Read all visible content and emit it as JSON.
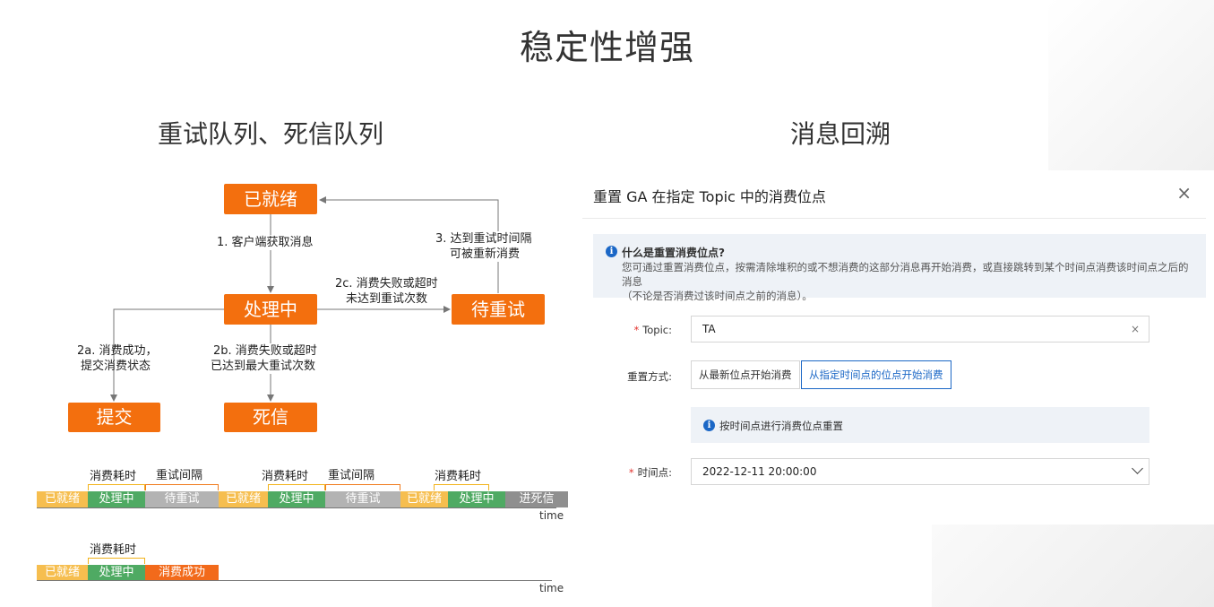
{
  "title": "稳定性增强",
  "left": {
    "subtitle": "重试队列、死信队列",
    "nodes": {
      "ready": "已就绪",
      "processing": "处理中",
      "waiting_retry": "待重试",
      "commit": "提交",
      "dead_letter": "死信"
    },
    "edges": {
      "e1": "1. 客户端获取消息",
      "e2a_1": "2a. 消费成功，",
      "e2a_2": "提交消费状态",
      "e2b_1": "2b. 消费失败或超时",
      "e2b_2": "已达到最大重试次数",
      "e2c_1": "2c. 消费失败或超时",
      "e2c_2": "未达到重试次数",
      "e3_1": "3. 达到重试时间隔",
      "e3_2": "可被重新消费"
    },
    "timeline1": {
      "segments": [
        "已就绪",
        "处理中",
        "待重试",
        "已就绪",
        "处理中",
        "待重试",
        "已就绪",
        "处理中",
        "进死信"
      ],
      "brackets": [
        "消费耗时",
        "重试间隔",
        "消费耗时",
        "重试间隔",
        "消费耗时"
      ],
      "axis_label": "time"
    },
    "timeline2": {
      "segments": [
        "已就绪",
        "处理中",
        "消费成功"
      ],
      "brackets": [
        "消费耗时"
      ],
      "axis_label": "time"
    }
  },
  "right": {
    "subtitle": "消息回溯",
    "dialog": {
      "title": "重置 GA 在指定 Topic 中的消费位点",
      "close_icon": "×",
      "info_title": "什么是重置消费位点?",
      "info_line1": "您可通过重置消费位点，按需清除堆积的或不想消费的这部分消息再开始消费，或直接跳转到某个时间点消费该时间点之后的消息",
      "info_line2": "（不论是否消费过该时间点之前的消息）。",
      "topic_label": "Topic:",
      "topic_value": "TA",
      "clear_icon": "×",
      "mode_label": "重置方式:",
      "mode_options": [
        "从最新位点开始消费",
        "从指定时间点的位点开始消费"
      ],
      "mode_selected": "从指定时间点的位点开始消费",
      "hint": "按时间点进行消费位点重置",
      "time_label": "时间点:",
      "time_value": "2022-12-11 20:00:00",
      "required_mark": "*",
      "accent": "#1b67c6"
    }
  },
  "colors": {
    "node": "#f36f0e",
    "ready": "#f6be4f",
    "processing": "#4faa63",
    "waiting": "#b3b3b3",
    "dead": "#8f8f8f",
    "success": "#f26a1b"
  }
}
